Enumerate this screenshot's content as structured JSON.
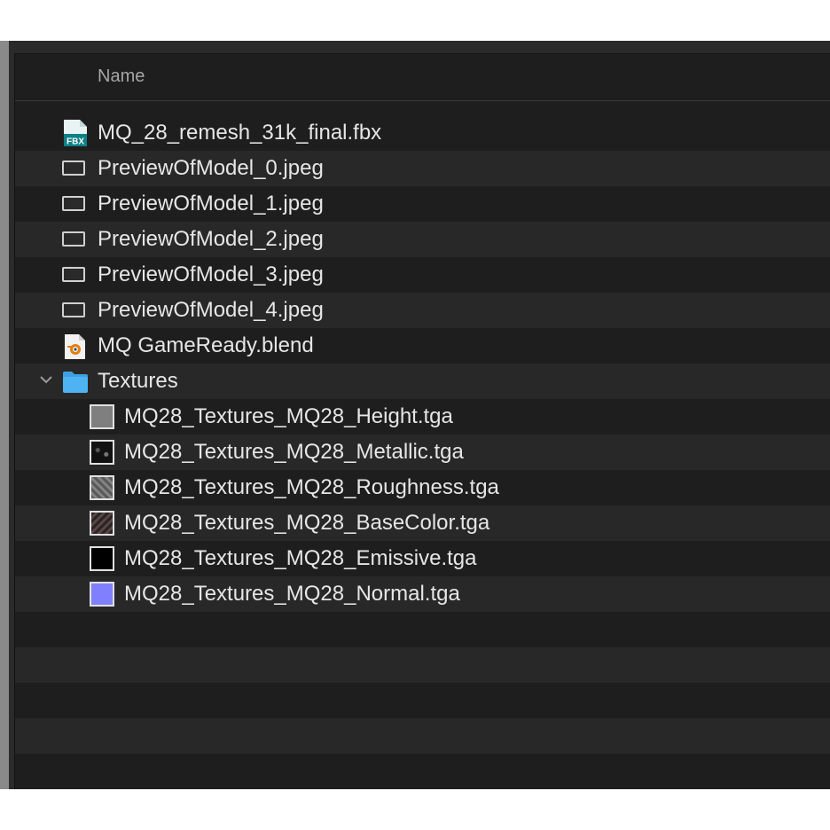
{
  "header": {
    "name_column": "Name"
  },
  "files": [
    {
      "name": "MQ_28_remesh_31k_final.fbx",
      "icon": "fbx-file-icon",
      "badge": "FBX"
    },
    {
      "name": "PreviewOfModel_0.jpeg",
      "icon": "image-file-icon"
    },
    {
      "name": "PreviewOfModel_1.jpeg",
      "icon": "image-file-icon"
    },
    {
      "name": "PreviewOfModel_2.jpeg",
      "icon": "image-file-icon"
    },
    {
      "name": "PreviewOfModel_3.jpeg",
      "icon": "image-file-icon"
    },
    {
      "name": "PreviewOfModel_4.jpeg",
      "icon": "image-file-icon"
    },
    {
      "name": "MQ GameReady.blend",
      "icon": "blender-file-icon"
    }
  ],
  "folder": {
    "name": "Textures",
    "icon": "folder-icon",
    "expanded": true,
    "color": "#4db3f2",
    "children": [
      {
        "name": "MQ28_Textures_MQ28_Height.tga",
        "icon": "texture-thumbnail-icon",
        "swatch": "#7f7f7f"
      },
      {
        "name": "MQ28_Textures_MQ28_Metallic.tga",
        "icon": "texture-thumbnail-icon",
        "swatch": "#111111"
      },
      {
        "name": "MQ28_Textures_MQ28_Roughness.tga",
        "icon": "texture-thumbnail-icon",
        "swatch": "#6d6d6d"
      },
      {
        "name": "MQ28_Textures_MQ28_BaseColor.tga",
        "icon": "texture-thumbnail-icon",
        "swatch": "#3a3232"
      },
      {
        "name": "MQ28_Textures_MQ28_Emissive.tga",
        "icon": "texture-thumbnail-icon",
        "swatch": "#000000"
      },
      {
        "name": "MQ28_Textures_MQ28_Normal.tga",
        "icon": "texture-thumbnail-icon",
        "swatch": "#8080ff"
      }
    ]
  },
  "colors": {
    "background": "#1e1e1e",
    "alt_row": "#282828",
    "text": "#e6e6e6",
    "header_text": "#a6a6a6"
  }
}
